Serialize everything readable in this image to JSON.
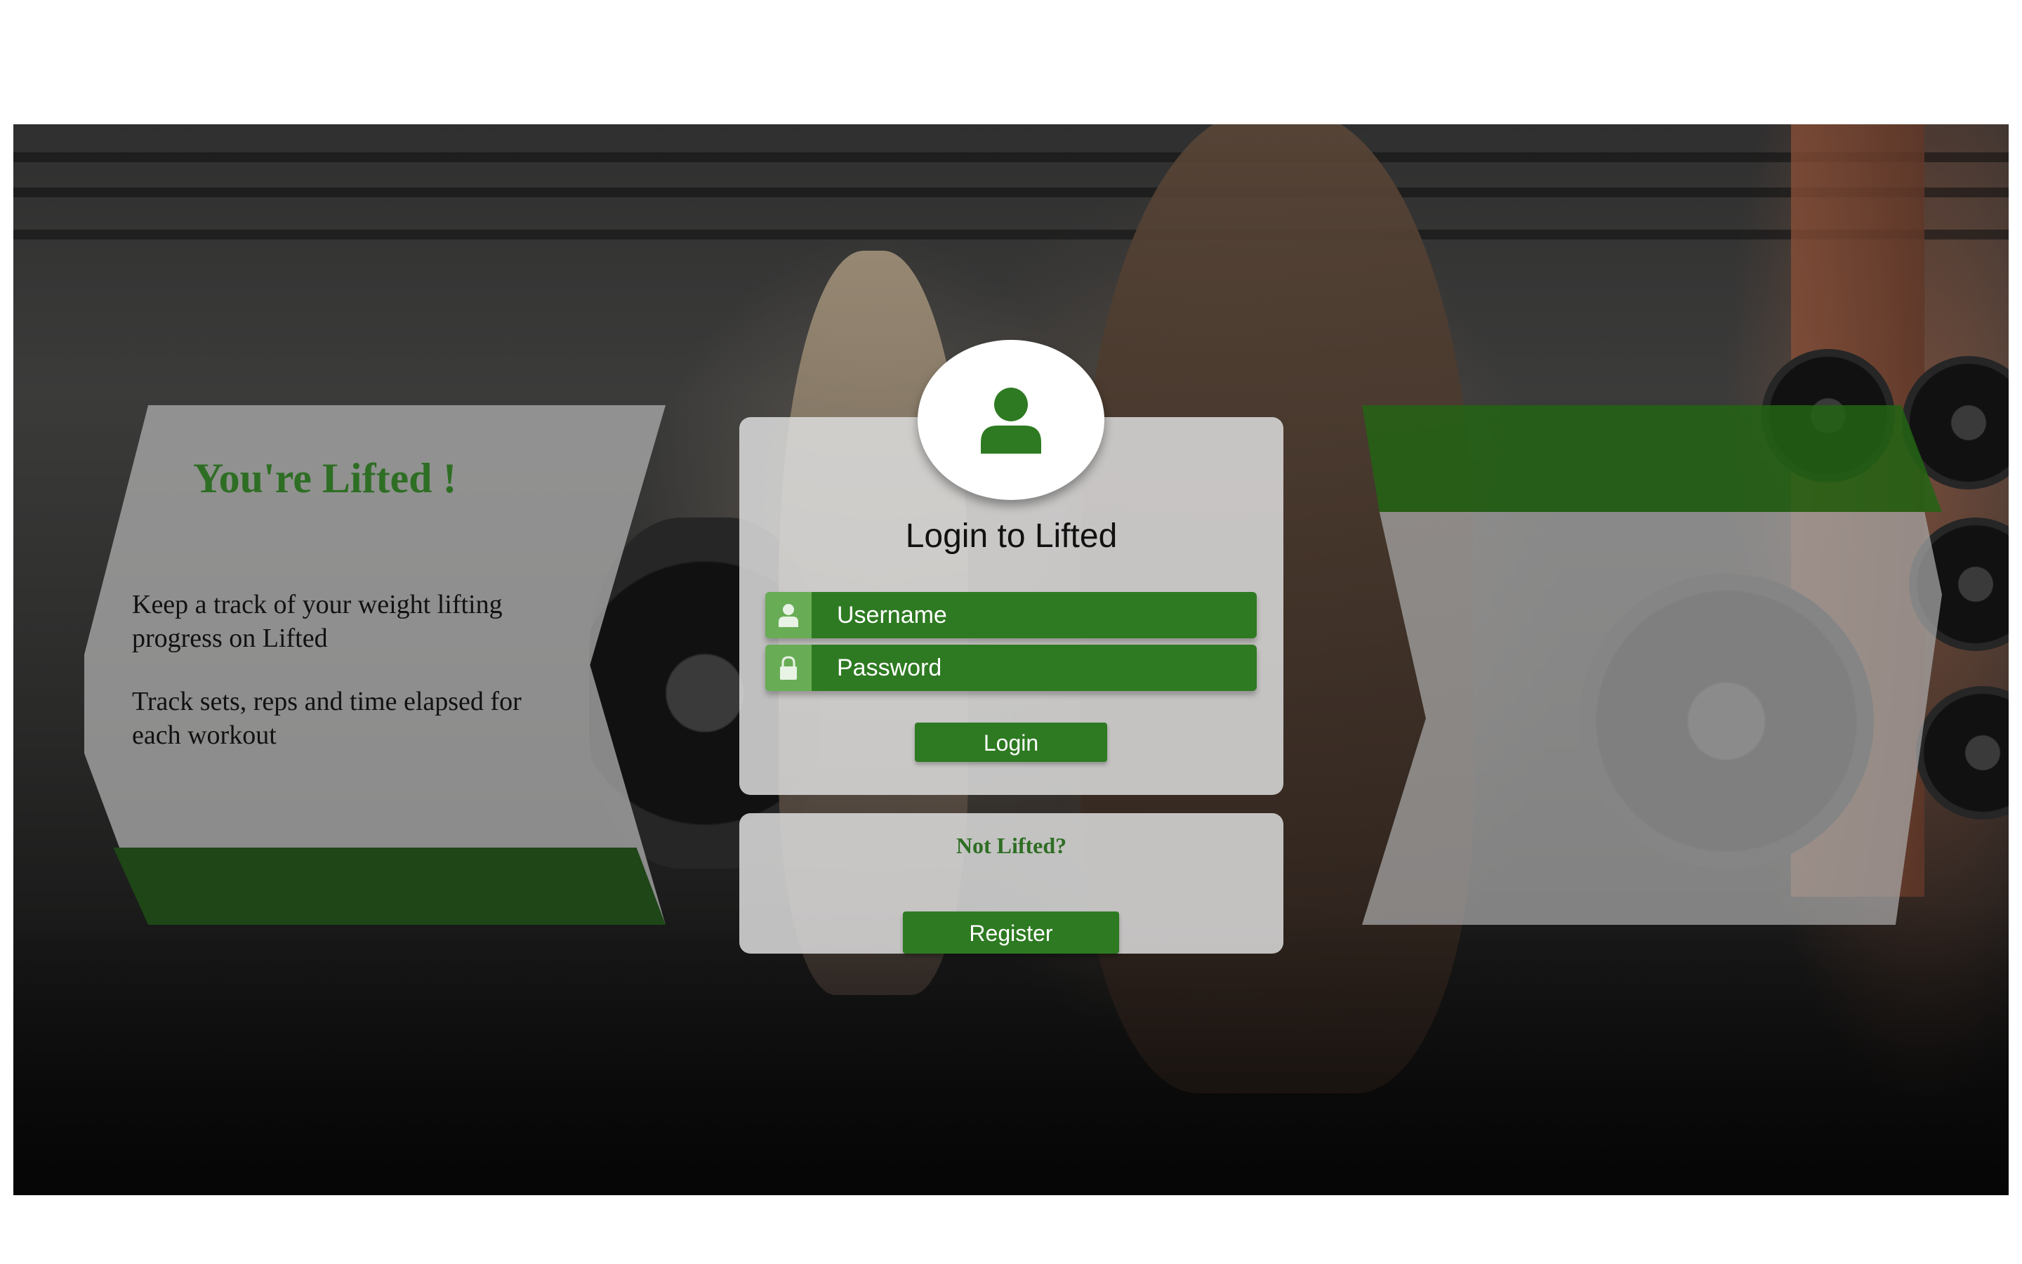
{
  "info": {
    "title": "You're Lifted !",
    "paragraphs": [
      "Keep a track of your weight lifting progress on Lifted",
      "Track sets, reps and time elapsed for each workout"
    ]
  },
  "login": {
    "title": "Login to Lifted",
    "username_placeholder": "Username",
    "password_placeholder": "Password",
    "login_label": "Login",
    "icons": {
      "avatar": "user-avatar-icon",
      "username": "user-icon",
      "password": "lock-icon"
    }
  },
  "register": {
    "prompt": "Not Lifted?",
    "register_label": "Register"
  },
  "colors": {
    "accent": "#2e7a22",
    "accent_light": "#68ad55",
    "title_green": "#2e6e24",
    "dark_band": "#1e4616",
    "panel": "#dcdcdc"
  }
}
